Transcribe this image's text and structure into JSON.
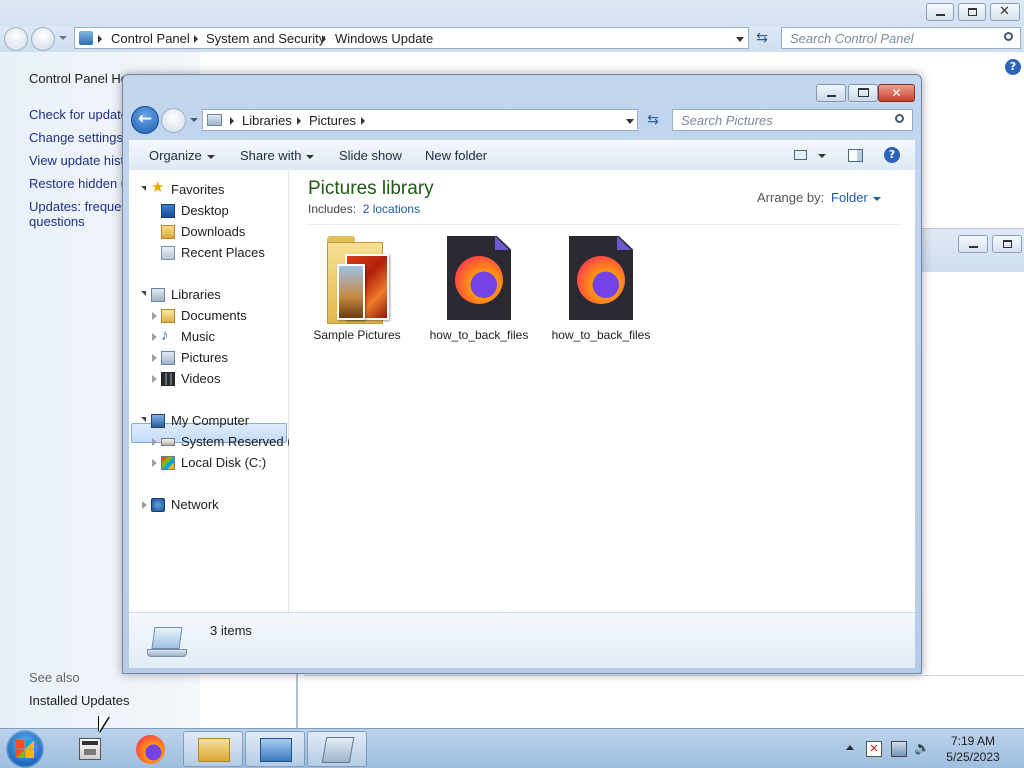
{
  "control_panel": {
    "breadcrumb": [
      "Control Panel",
      "System and Security",
      "Windows Update"
    ],
    "search_placeholder": "Search Control Panel",
    "left_links": [
      "Control Panel Hor",
      "Check for updates",
      "Change settings",
      "View update histo",
      "Restore hidden up",
      "Updates: frequent",
      "questions"
    ],
    "see_also_label": "See also",
    "see_also_links": [
      "Installed Updates"
    ]
  },
  "explorer": {
    "breadcrumb": [
      "Libraries",
      "Pictures"
    ],
    "search_placeholder": "Search Pictures",
    "toolbar": {
      "organize": "Organize",
      "share_with": "Share with",
      "slide_show": "Slide show",
      "new_folder": "New folder"
    },
    "nav": {
      "favorites": "Favorites",
      "desktop": "Desktop",
      "downloads": "Downloads",
      "recent_places": "Recent Places",
      "libraries": "Libraries",
      "documents": "Documents",
      "music": "Music",
      "pictures": "Pictures",
      "videos": "Videos",
      "my_computer": "My Computer",
      "system_reserved": "System Reserved (A:",
      "local_disk": "Local Disk (C:)",
      "network": "Network"
    },
    "library": {
      "title": "Pictures library",
      "includes_label": "Includes:",
      "includes_link": "2 locations",
      "arrange_label": "Arrange by:",
      "arrange_value": "Folder"
    },
    "files": [
      {
        "name": "Sample Pictures",
        "icon": "folder-icon"
      },
      {
        "name": "how_to_back_files",
        "icon": "firefox-icon"
      },
      {
        "name": "how_to_back_files",
        "icon": "firefox-icon"
      }
    ],
    "status": {
      "count": "3 items"
    }
  },
  "taskbar": {
    "time": "7:19 AM",
    "date": "5/25/2023"
  },
  "colors": {
    "library_title": "#1e5a14",
    "link": "#1c59a6",
    "nav_selected": "#c4ddfa"
  }
}
